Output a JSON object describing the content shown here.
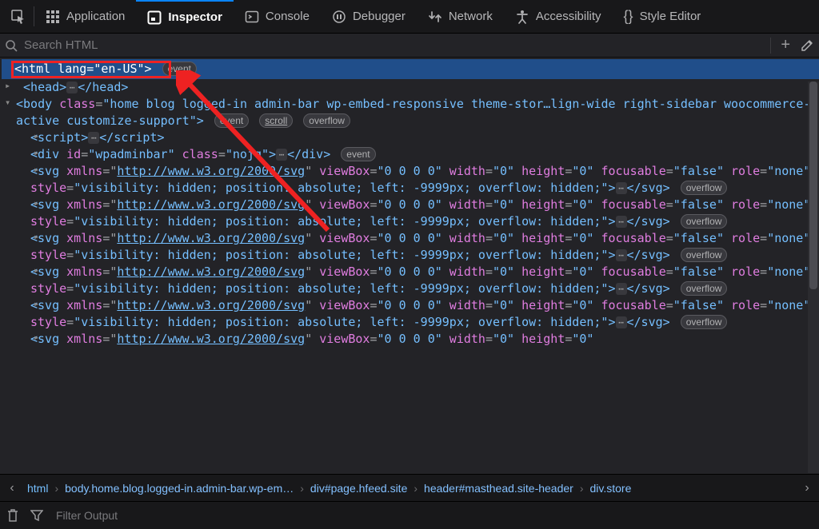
{
  "toolbar": {
    "tabs": [
      {
        "id": "application",
        "label": "Application"
      },
      {
        "id": "inspector",
        "label": "Inspector"
      },
      {
        "id": "console",
        "label": "Console"
      },
      {
        "id": "debugger",
        "label": "Debugger"
      },
      {
        "id": "network",
        "label": "Network"
      },
      {
        "id": "accessibility",
        "label": "Accessibility"
      },
      {
        "id": "style",
        "label": "Style Editor"
      }
    ],
    "active_tab": "inspector"
  },
  "search": {
    "placeholder": "Search HTML"
  },
  "tree": {
    "selected_line": "<html lang=\"en-US\">",
    "selected_badge": "event",
    "head_open": "<head>",
    "head_close": "</head>",
    "body_line": "<body class=\"home blog logged-in admin-bar wp-embed-responsive theme-stor…lign-wide right-sidebar woocommerce-active customize-support\">",
    "body_badges": [
      "event",
      "scroll",
      "overflow"
    ],
    "script_open": "<script>",
    "script_close": "</script>",
    "div_line": "<div id=\"wpadminbar\" class=\"nojq\">",
    "div_close": "</div>",
    "div_badge": "event",
    "svg_xmlns": "http://www.w3.org/2000/svg",
    "svg_attrs_1": " viewBox=\"0 0 0 0\" width=\"0\" height=\"0\" focusable=\"false\" role=\"none\" style=\"visibility: hidden; position: absolute; left: -9999px; overflow: hidden;\">",
    "svg_close": "</svg>",
    "svg_badge": "overflow",
    "svg_short": " viewBox=\"0 0 0 0\" width=\"0\" height=\"0\""
  },
  "breadcrumbs": [
    "html",
    "body.home.blog.logged-in.admin-bar.wp-em…",
    "div#page.hfeed.site",
    "header#masthead.site-header",
    "div.store"
  ],
  "console": {
    "placeholder": "Filter Output"
  }
}
